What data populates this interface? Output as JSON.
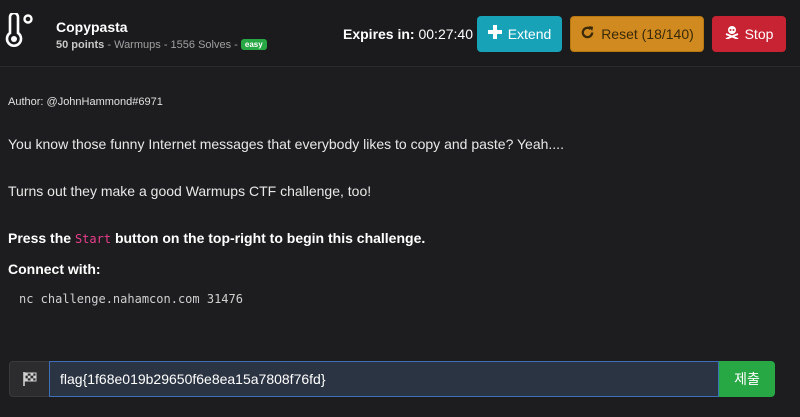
{
  "challenge": {
    "title": "Copypasta",
    "points": "50 points",
    "category": "Warmups",
    "solves": "1556 Solves",
    "difficulty": "easy",
    "category_icon": "thermometer-icon"
  },
  "timer": {
    "label": "Expires in:",
    "value": "00:27:40"
  },
  "actions": {
    "extend_label": "Extend",
    "extend_icon": "plus-icon",
    "reset_label": "Reset (18/140)",
    "reset_icon": "refresh-icon",
    "stop_label": "Stop",
    "stop_icon": "skull-crossbones-icon"
  },
  "description": {
    "author": "Author: @JohnHammond#6971",
    "paragraph1": "You know those funny Internet messages that everybody likes to copy and paste? Yeah....",
    "paragraph2": "Turns out they make a good Warmups CTF challenge, too!",
    "instruction_prefix": "Press the ",
    "instruction_code": "Start",
    "instruction_suffix": " button on the top-right to begin this challenge.",
    "connect_label": "Connect with:",
    "connect_command": "nc challenge.nahamcon.com 31476"
  },
  "flag_form": {
    "prefix_icon": "checkered-flag-icon",
    "value": "flag{1f68e019b29650f6e8ea15a7808f76fd}",
    "submit_label": "제출"
  },
  "colors": {
    "extend": "#17a2b8",
    "reset": "#d08a1f",
    "stop": "#c82333",
    "submit": "#28a745",
    "easy_badge": "#28a745",
    "code_accent": "#e83e8c"
  }
}
